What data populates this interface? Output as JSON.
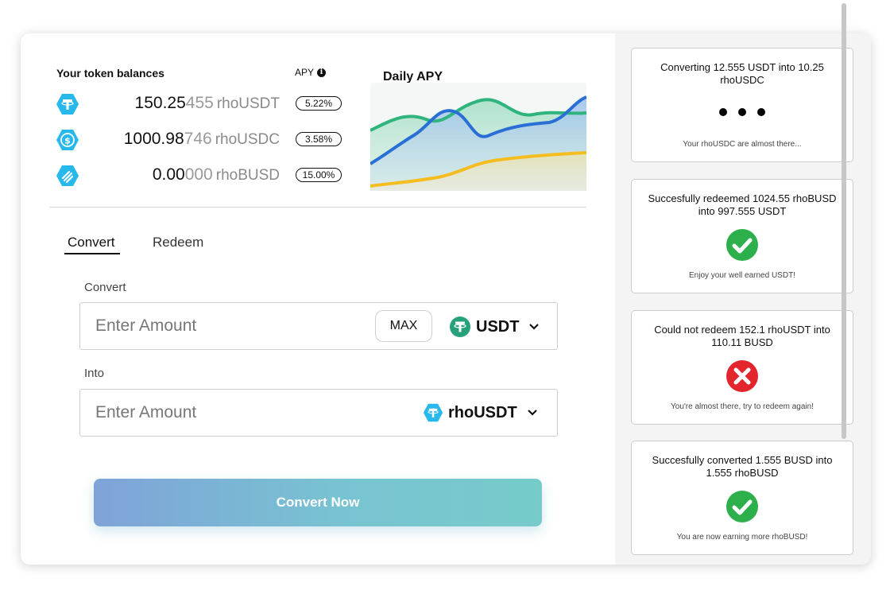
{
  "balances": {
    "title": "Your token balances",
    "apy_header": "APY",
    "rows": [
      {
        "amount_main": "150.25",
        "amount_rest": "455",
        "symbol": "rhoUSDT",
        "apy": "5.22%",
        "icon": "rhousdt-icon"
      },
      {
        "amount_main": "1000.98",
        "amount_rest": "746",
        "symbol": "rhoUSDC",
        "apy": "3.58%",
        "icon": "rhousdc-icon"
      },
      {
        "amount_main": "0.00",
        "amount_rest": "000",
        "symbol": "rhoBUSD",
        "apy": "15.00%",
        "icon": "rhobusd-icon"
      }
    ]
  },
  "daily_apy": {
    "title": "Daily APY",
    "colors": {
      "green": "#2fb47d",
      "blue": "#2a6fd6",
      "yellow": "#f5bd1f"
    }
  },
  "tabs": [
    {
      "label": "Convert",
      "active": true
    },
    {
      "label": "Redeem",
      "active": false
    }
  ],
  "form": {
    "from_label": "Convert",
    "from_placeholder": "Enter Amount",
    "max_label": "MAX",
    "from_token": "USDT",
    "into_label": "Into",
    "into_placeholder": "Enter Amount",
    "into_token": "rhoUSDT",
    "submit_label": "Convert Now"
  },
  "notifications": [
    {
      "message": "Converting 12.555 USDT into 10.25 rhoUSDC",
      "status_text": "Your rhoUSDC are almost there...",
      "state": "pending"
    },
    {
      "message": "Succesfully redeemed 1024.55 rhoBUSD into 997.555 USDT",
      "status_text": "Enjoy your well earned USDT!",
      "state": "success"
    },
    {
      "message": "Could not redeem 152.1 rhoUSDT into 110.11 BUSD",
      "status_text": "You're almost there, try to redeem again!",
      "state": "error"
    },
    {
      "message": "Succesfully converted 1.555 BUSD into 1.555 rhoBUSD",
      "status_text": "You are now earning more rhoBUSD!",
      "state": "success"
    }
  ],
  "colors": {
    "success": "#2db04b",
    "error": "#e3262e",
    "accent_teal": "#2ab1c4",
    "token_blue": "#27b9ec"
  }
}
